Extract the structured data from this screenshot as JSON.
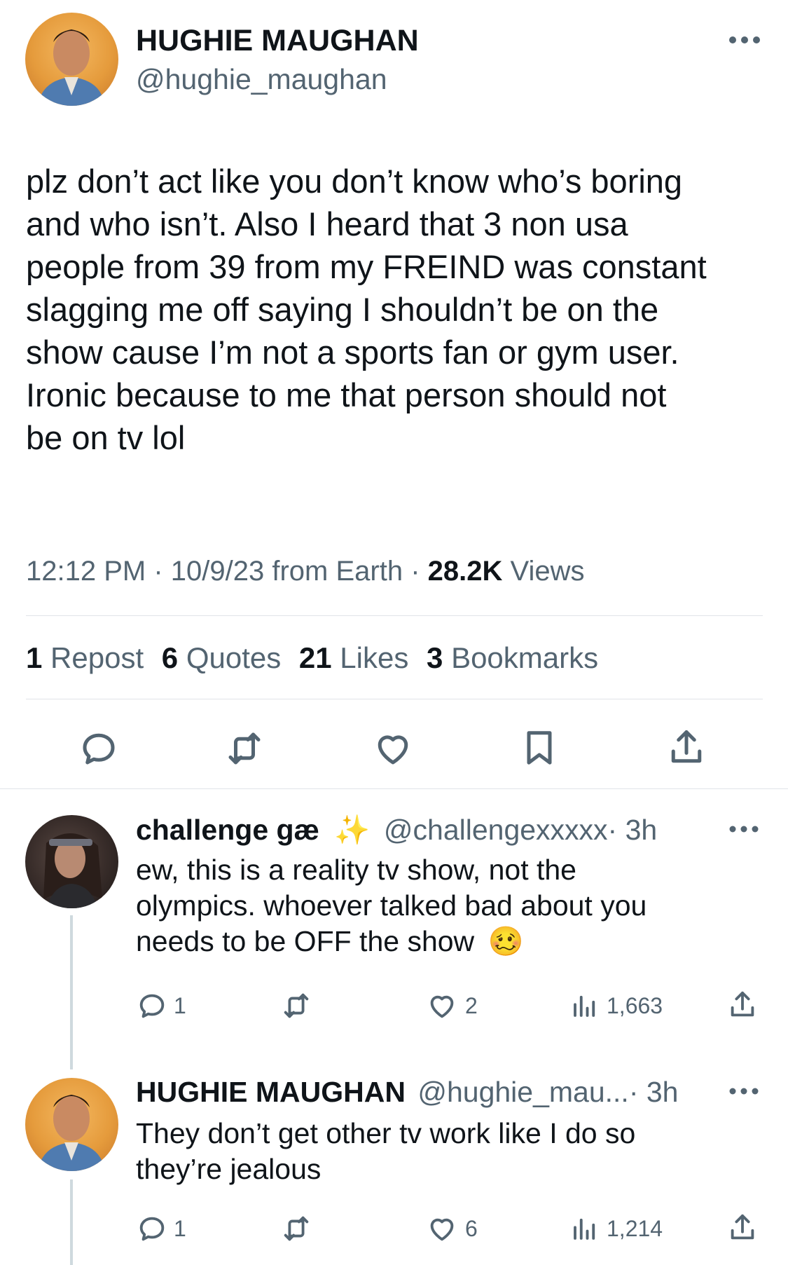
{
  "main_tweet": {
    "author_name": "HUGHIE MAUGHAN",
    "author_handle": "@hughie_maughan",
    "text_lines": [
      "plz don’t act like you don’t know who’s boring",
      "and who isn’t. Also I heard that 3 non usa",
      "people from 39 from my FREIND was constant",
      "slagging me off saying I shouldn’t be on the",
      "show cause I’m not a sports fan or gym user.",
      "Ironic because to me that person should not",
      "be on tv lol"
    ],
    "meta": {
      "time": "12:12 PM",
      "sep1": "·",
      "date": "10/9/23 from Earth",
      "sep2": "·",
      "views_count": "28.2K",
      "views_label": "Views"
    },
    "stats": {
      "reposts_count": "1",
      "reposts_label": "Repost",
      "quotes_count": "6",
      "quotes_label": "Quotes",
      "likes_count": "21",
      "likes_label": "Likes",
      "bookmarks_count": "3",
      "bookmarks_label": "Bookmarks"
    }
  },
  "replies": [
    {
      "author_name": "challenge gæ",
      "author_emoji": "✨",
      "author_handle": "@challengexxxxx",
      "time": "· 3h",
      "text_lines": [
        "ew, this is a reality tv show, not the",
        "olympics. whoever talked bad about you",
        "needs to be OFF the show"
      ],
      "trailing_emoji": "🥴",
      "reply_count": "1",
      "repost_count": "",
      "like_count": "2",
      "view_count": "1,663"
    },
    {
      "author_name": "HUGHIE MAUGHAN",
      "author_handle": "@hughie_mau...",
      "time": "· 3h",
      "text_lines": [
        "They don’t get other tv work like I do so",
        "they’re jealous"
      ],
      "reply_count": "1",
      "repost_count": "",
      "like_count": "6",
      "view_count": "1,214"
    }
  ],
  "icons": {
    "more": "more-icon",
    "reply": "reply-icon",
    "repost": "repost-icon",
    "like": "heart-icon",
    "bookmark": "bookmark-icon",
    "share": "share-icon",
    "views": "views-icon"
  },
  "colors": {
    "text": "#0f1419",
    "muted": "#536471",
    "divider": "#e1e4e8",
    "thread_line": "#cfd9de"
  }
}
